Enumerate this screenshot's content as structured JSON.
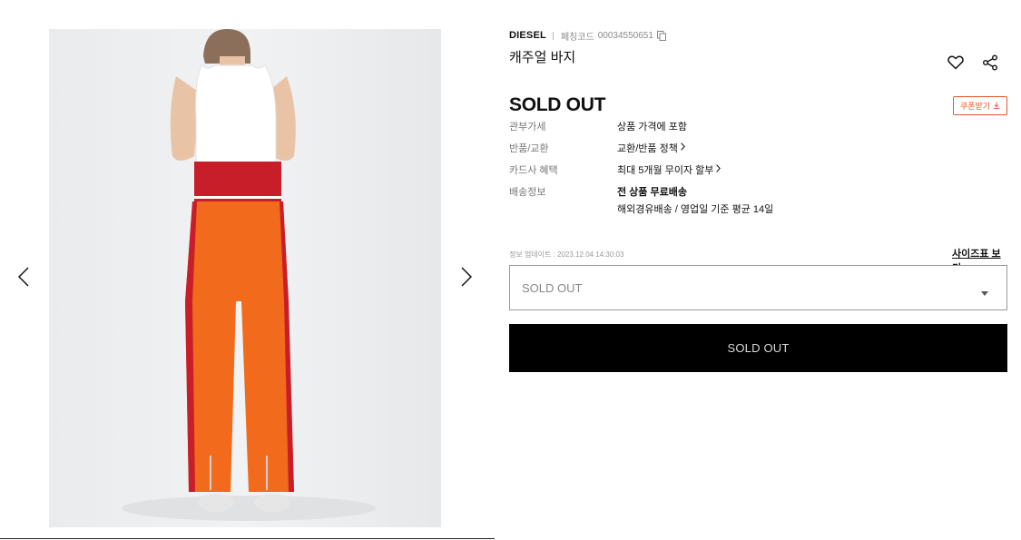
{
  "product": {
    "brand": "DIESEL",
    "code_label": "페칭코드",
    "code_value": "00034550651",
    "name": "캐주얼 바지",
    "status_title": "SOLD OUT",
    "coupon_label": "쿠폰받기"
  },
  "details": [
    {
      "label": "관부가세",
      "value": "상품 가격에 포함"
    },
    {
      "label": "반품/교환",
      "value": "교환/반품 정책"
    },
    {
      "label": "카드사 혜택",
      "value": "최대 5개월 무이자 할부"
    },
    {
      "label": "배송정보",
      "value": "전 상품 무료배송",
      "sub": "해외경유배송 / 영업일 기준 평균 14일"
    }
  ],
  "update_text": "정보 업데이트 : 2023.12.04 14:30:03",
  "size_chart_label": "사이즈표 보기",
  "option_select": {
    "value": "SOLD OUT"
  },
  "buy_button_label": "SOLD OUT",
  "icons": {
    "prev": "chevron-left-icon",
    "next": "chevron-right-icon",
    "copy": "copy-icon",
    "wishlist": "heart-icon",
    "share": "share-icon",
    "coupon": "download-icon",
    "select": "caret-down-icon"
  },
  "colors": {
    "coupon_accent": "#e4572e",
    "buy_button_bg": "#000000",
    "pants": "#f26a1b",
    "waistband": "#c81e2a"
  }
}
